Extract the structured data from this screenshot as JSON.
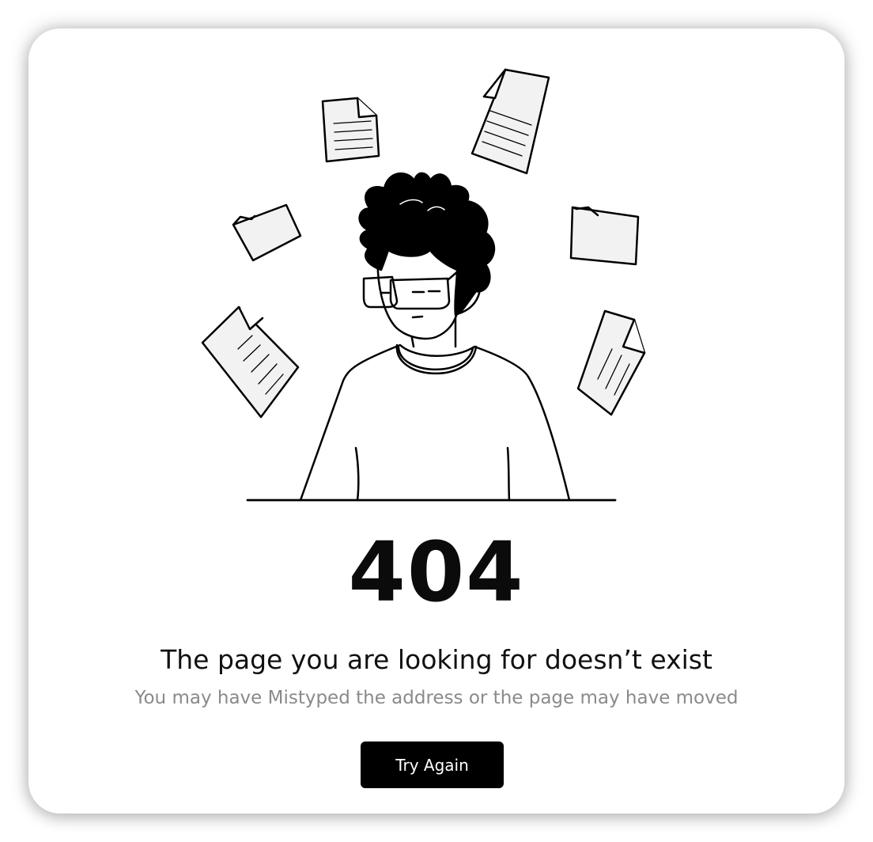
{
  "error": {
    "code": "404",
    "title": "The page you are looking for doesn’t exist",
    "subtitle": "You may have Mistyped the address or the page may have moved"
  },
  "actions": {
    "retry_label": "Try Again"
  },
  "illustration": {
    "subject": "person-with-glasses-surrounded-by-floating-documents",
    "icons": [
      "document-icon",
      "document-icon",
      "folder-icon",
      "folder-icon",
      "document-icon",
      "document-icon"
    ]
  },
  "colors": {
    "background": "#ffffff",
    "ink": "#000000",
    "muted_text": "#8a8a8a",
    "paper_fill": "#f2f2f2",
    "button_bg": "#000000",
    "button_text": "#ffffff"
  }
}
